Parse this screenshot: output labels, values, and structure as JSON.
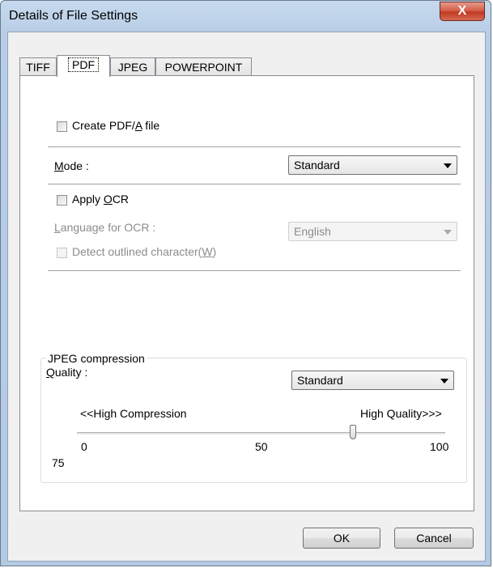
{
  "window": {
    "title": "Details of File Settings",
    "close_glyph": "X"
  },
  "tabs": [
    {
      "label": "TIFF"
    },
    {
      "label": "PDF"
    },
    {
      "label": "JPEG"
    },
    {
      "label": "POWERPOINT"
    }
  ],
  "pdf": {
    "create_pdfa": {
      "label_pre": "Create PDF/",
      "label_u": "A",
      "label_post": " file",
      "checked": false
    },
    "mode": {
      "label_u": "M",
      "label_post": "ode :",
      "value": "Standard"
    },
    "apply_ocr": {
      "label_pre": "Apply ",
      "label_u": "O",
      "label_post": "CR",
      "checked": false
    },
    "language": {
      "label_u": "L",
      "label_post": "anguage for OCR :",
      "value": "English"
    },
    "detect_outlined": {
      "label_pre": "Detect outlined character(",
      "label_u": "W",
      "label_post": ")",
      "checked": false
    }
  },
  "jpeg_compression": {
    "group_title": "JPEG compression",
    "quality_label_u": "Q",
    "quality_label_post": "uality :",
    "quality_value": "Standard",
    "low_label": "<<High Compression",
    "high_label": "High Quality>>>",
    "tick_min": "0",
    "tick_mid": "50",
    "tick_max": "100",
    "current_value": "75",
    "slider_value": 75
  },
  "buttons": {
    "ok": "OK",
    "cancel": "Cancel"
  }
}
